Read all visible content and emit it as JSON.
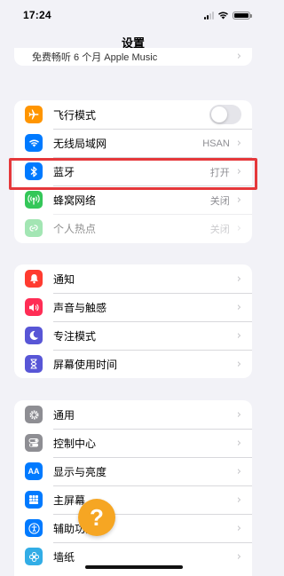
{
  "status_bar": {
    "time": "17:24"
  },
  "nav": {
    "title": "设置"
  },
  "top_group": {
    "partial_label": "免费畅听 6 个月 Apple Music"
  },
  "connectivity": [
    {
      "label": "飞行模式",
      "icon": "airplane-icon",
      "color": "#ff9500",
      "toggle": false
    },
    {
      "label": "无线局域网",
      "icon": "wifi-icon",
      "color": "#007aff",
      "value": "HSAN"
    },
    {
      "label": "蓝牙",
      "icon": "bluetooth-icon",
      "color": "#007aff",
      "value": "打开"
    },
    {
      "label": "蜂窝网络",
      "icon": "antenna-icon",
      "color": "#34c759",
      "value": "关闭",
      "highlighted": true
    },
    {
      "label": "个人热点",
      "icon": "hotspot-icon",
      "color": "#34c759",
      "value": "关闭",
      "disabled": true
    }
  ],
  "notifications": [
    {
      "label": "通知",
      "icon": "bell-icon",
      "color": "#ff3b30"
    },
    {
      "label": "声音与触感",
      "icon": "speaker-icon",
      "color": "#ff2d55"
    },
    {
      "label": "专注模式",
      "icon": "moon-icon",
      "color": "#5856d6"
    },
    {
      "label": "屏幕使用时间",
      "icon": "hourglass-icon",
      "color": "#5856d6"
    }
  ],
  "general": [
    {
      "label": "通用",
      "icon": "gear-icon",
      "color": "#8e8e93"
    },
    {
      "label": "控制中心",
      "icon": "switches-icon",
      "color": "#8e8e93"
    },
    {
      "label": "显示与亮度",
      "icon": "text-size-icon",
      "color": "#007aff"
    },
    {
      "label": "主屏幕",
      "icon": "grid-icon",
      "color": "#007aff"
    },
    {
      "label": "辅助功能",
      "icon": "accessibility-icon",
      "color": "#007aff"
    },
    {
      "label": "墙纸",
      "icon": "flower-icon",
      "color": "#32ade6"
    }
  ],
  "chevron": "›",
  "help": "?"
}
